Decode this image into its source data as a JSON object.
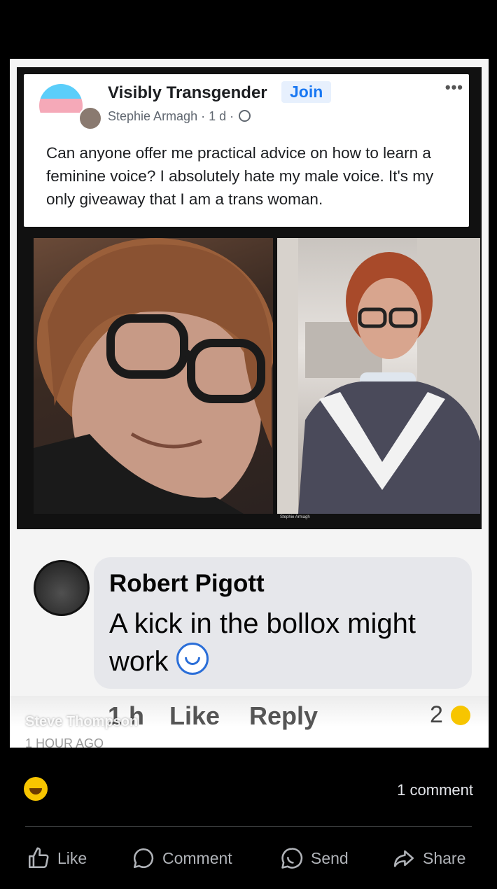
{
  "shared_post": {
    "group_name": "Visibly Transgender",
    "join_label": "Join",
    "author": "Stephie Armagh",
    "time": "1 d",
    "menu": "•••",
    "text": "Can anyone offer me practical advice on how to learn a feminine voice? I absolutely hate my male voice. It's my only giveaway that I am a trans woman.",
    "photo_caption": "Stephie Armagh"
  },
  "comment": {
    "author": "Robert Pigott",
    "text": "A kick in the bollox might work",
    "time": "1 h",
    "like_label": "Like",
    "reply_label": "Reply",
    "reaction_count": "2"
  },
  "overlay": {
    "name": "Steve Thompson",
    "ago": "1 HOUR AGO"
  },
  "footer": {
    "comment_count": "1 comment",
    "actions": [
      "Like",
      "Comment",
      "Send",
      "Share"
    ]
  },
  "colors": {
    "background": "#000000",
    "link_blue": "#1877f2",
    "trans_blue": "#5bcefa",
    "trans_pink": "#f5a9b8",
    "reaction_yellow": "#f7c500"
  }
}
